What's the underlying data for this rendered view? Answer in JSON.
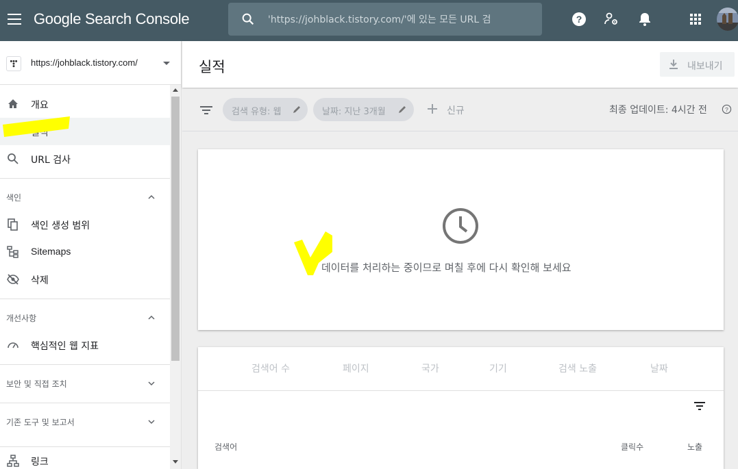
{
  "app": {
    "title": "Google Search Console"
  },
  "search": {
    "placeholder": "'https://johblack.tistory.com/'에 있는 모든 URL 검"
  },
  "property": {
    "url": "https://johblack.tistory.com/"
  },
  "sidebar": {
    "items": [
      {
        "label": "개요",
        "icon": "home-icon"
      },
      {
        "label": "실적",
        "icon": "trending-up-icon",
        "active": true
      },
      {
        "label": "URL 검사",
        "icon": "search-icon"
      }
    ],
    "sections": [
      {
        "label": "색인",
        "expanded": true,
        "items": [
          {
            "label": "색인 생성 범위",
            "icon": "file-copy-icon"
          },
          {
            "label": "Sitemaps",
            "icon": "sitemap-icon"
          },
          {
            "label": "삭제",
            "icon": "visibility-off-icon"
          }
        ]
      },
      {
        "label": "개선사항",
        "expanded": true,
        "items": [
          {
            "label": "핵심적인 웹 지표",
            "icon": "speed-gauge-icon"
          }
        ]
      },
      {
        "label": "보안 및 직접 조치",
        "expanded": false
      },
      {
        "label": "기존 도구 및 보고서",
        "expanded": false
      },
      {
        "label": "링크",
        "icon": "links-icon"
      }
    ]
  },
  "main": {
    "title": "실적",
    "export_label": "내보내기",
    "filters": {
      "chips": [
        "검색 유형: 웹",
        "날짜: 지난 3개월"
      ],
      "new_label": "신규",
      "updated": "최종 업데이트: 4시간 전"
    },
    "processing_message": "데이터를 처리하는 중이므로 며칠 후에 다시 확인해 보세요",
    "tabs": [
      "검색어 수",
      "페이지",
      "국가",
      "기기",
      "검색 노출",
      "날짜"
    ],
    "table": {
      "columns": [
        "검색어",
        "클릭수",
        "노출"
      ]
    }
  },
  "colors": {
    "topbar": "#455a64",
    "highlight": "#ffff00",
    "active_bg": "#f1f3f4"
  }
}
